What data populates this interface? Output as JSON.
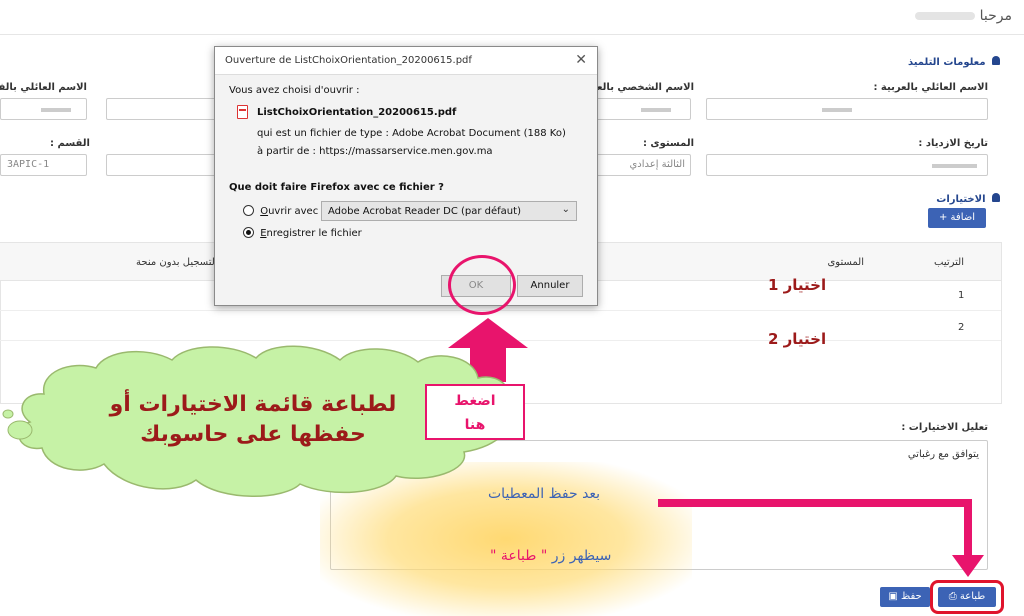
{
  "greeting": "مرحبا",
  "student_section": {
    "title": "معلومات التلميذ",
    "fields": {
      "last_name_ar": "الاسم العائلي بالعربية :",
      "first_name_ar": "الاسم الشخصي بالعر",
      "last_name_fr": "الاسم العائلي بالفرن",
      "birth_date": "تاريخ الازدياد :",
      "level": "المستوى :",
      "level_value": "الثالثة إعدادي",
      "class": "القسم :",
      "class_value": "3APIC-1"
    }
  },
  "choices_section": {
    "title": "الاختيارات",
    "add_button": "+ اضافة",
    "table_headers": {
      "rank": "الترتيب",
      "level": "المستوى",
      "registration": "التسجيل بدون منحة"
    },
    "rows": [
      {
        "rank": "1",
        "annotation": "اختيار 1"
      },
      {
        "rank": "2",
        "annotation": "اختيار 2"
      }
    ]
  },
  "justification": {
    "label": "تعليل الاختيارات :",
    "value": "يتوافق مع رغباتي"
  },
  "buttons": {
    "print": "طباعة",
    "save": "حفظ"
  },
  "dialog": {
    "title": "Ouverture de ListChoixOrientation_20200615.pdf",
    "chosen": "Vous avez choisi d'ouvrir :",
    "filename": "ListChoixOrientation_20200615.pdf",
    "type_label": "qui est un fichier de type :",
    "type_value": "Adobe Acrobat Document (188 Ko)",
    "from_label": "à partir de :",
    "from_value": "https://massarservice.men.gov.ma",
    "question": "Que doit faire Firefox avec ce fichier ?",
    "open_with_pre": "",
    "open_with_u": "O",
    "open_with_post": "uvrir avec",
    "app_select": "Adobe Acrobat Reader DC (par défaut)",
    "save_file_u": "E",
    "save_file_post": "nregistrer le fichier",
    "ok": "OK",
    "cancel": "Annuler"
  },
  "annotations": {
    "cloud_line1": "لطباعة قائمة الاختيارات أو",
    "cloud_line2": "حفظها على حاسوبك",
    "press_line1": "اضغط",
    "press_line2": "هنا",
    "after_save": "بعد حفظ المعطيات",
    "print_appears_pre": "سيظهر زر",
    "print_appears_word": "\" طباعة \""
  },
  "colors": {
    "accent_blue": "#3c63b5",
    "highlight_pink": "#e8146c",
    "cloud_fill": "#c6f2a6",
    "cloud_text": "#9c1a1a",
    "annotation_red": "#9c1a1a"
  }
}
